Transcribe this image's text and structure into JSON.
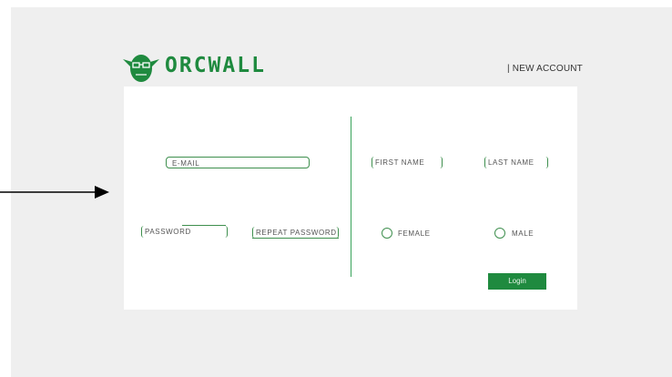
{
  "brand": {
    "name": "ORCWALL",
    "accent_color": "#1f8a3f"
  },
  "header": {
    "new_account_link": "| NEW ACCOUNT"
  },
  "form": {
    "email_placeholder": "E-MAIL",
    "password_placeholder": "PASSWORD",
    "repeat_password_placeholder": "REPEAT PASSWORD",
    "first_name_placeholder": "FIRST NAME",
    "last_name_placeholder": "LAST NAME",
    "gender_options": [
      "FEMALE",
      "MALE"
    ],
    "login_label": "Login"
  },
  "icons": {
    "logo": "orc-head-icon",
    "annotation": "arrow-right-icon"
  }
}
